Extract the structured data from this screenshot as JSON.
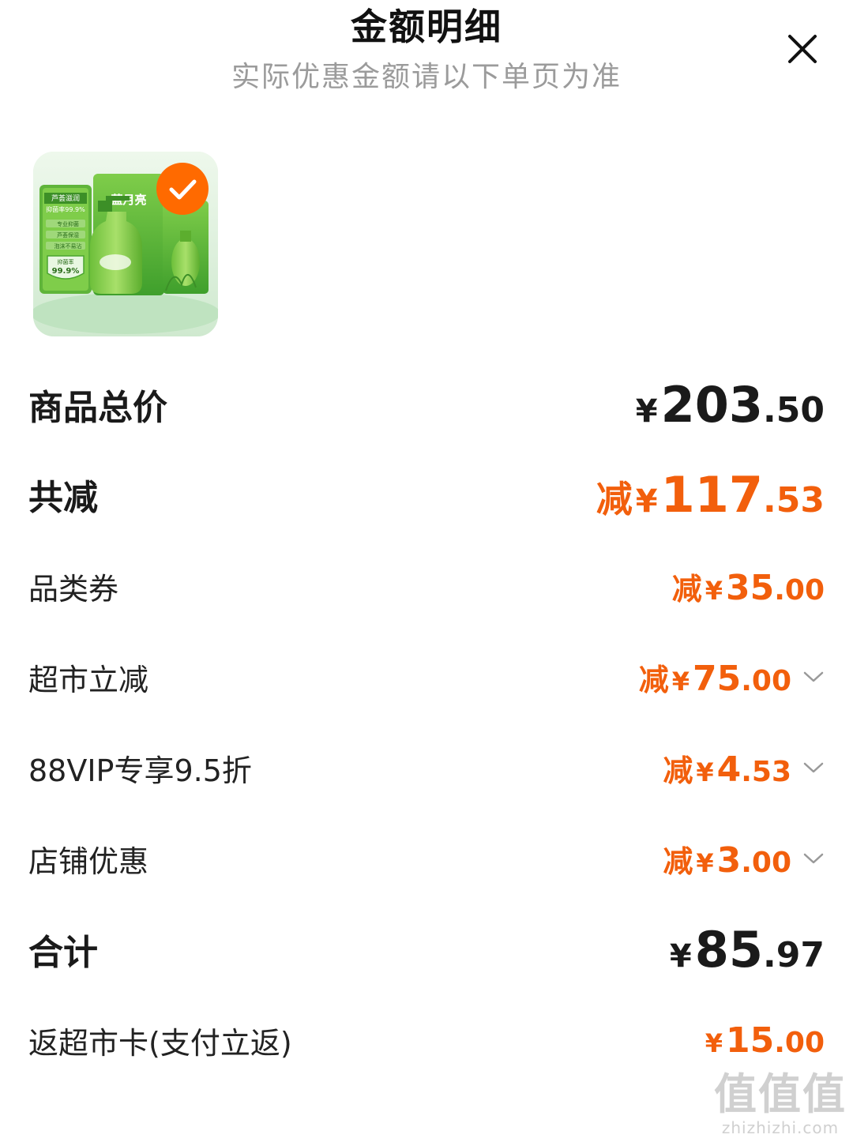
{
  "header": {
    "title": "金额明细",
    "subtitle": "实际优惠金额请以下单页为准"
  },
  "product": {
    "image_alt": "product-thumbnail",
    "brand_text": "蓝月亮",
    "badge_top": "芦荟滋润",
    "badge_rate": "抑菌率99.9%",
    "badge_rate_big": "99.9%",
    "badge_rate_label": "抑菌率",
    "features": [
      "专业抑菌",
      "芦荟保湿",
      "泡沫不易沾"
    ],
    "selected": true
  },
  "rows": [
    {
      "label": "商品总价",
      "prefix": "",
      "yen": "¥",
      "int": "203",
      "dec": ".50",
      "style": "total",
      "chevron": false
    },
    {
      "label": "共减",
      "prefix": "减",
      "yen": "¥",
      "int": "117",
      "dec": ".53",
      "style": "discount-total",
      "chevron": false
    },
    {
      "label": "品类券",
      "prefix": "减",
      "yen": "¥",
      "int": "35",
      "dec": ".00",
      "style": "discount",
      "chevron": false
    },
    {
      "label": "超市立减",
      "prefix": "减",
      "yen": "¥",
      "int": "75",
      "dec": ".00",
      "style": "discount",
      "chevron": true
    },
    {
      "label": "88VIP专享9.5折",
      "prefix": "减",
      "yen": "¥",
      "int": "4",
      "dec": ".53",
      "style": "discount",
      "chevron": true
    },
    {
      "label": "店铺优惠",
      "prefix": "减",
      "yen": "¥",
      "int": "3",
      "dec": ".00",
      "style": "discount",
      "chevron": true
    },
    {
      "label": "合计",
      "prefix": "",
      "yen": "¥",
      "int": "85",
      "dec": ".97",
      "style": "total",
      "chevron": false
    },
    {
      "label": "返超市卡(支付立返)",
      "prefix": "",
      "yen": "¥",
      "int": "15",
      "dec": ".00",
      "style": "rebate",
      "chevron": false
    }
  ],
  "watermark": {
    "main": "值值值",
    "sub": "zhizhizhi.com"
  },
  "colors": {
    "accent": "#f25f0c",
    "check": "#ff6a00",
    "text": "#1a1a1a",
    "subtext": "#9b9b9b"
  }
}
